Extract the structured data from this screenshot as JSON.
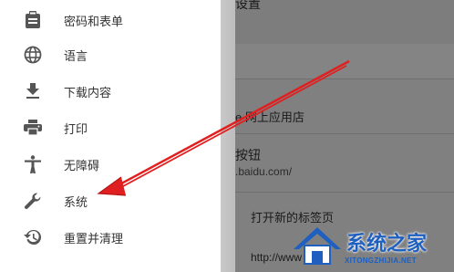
{
  "sidebar": {
    "items": [
      {
        "label": "密码和表单",
        "icon": "clipboard-icon"
      },
      {
        "label": "语言",
        "icon": "globe-icon"
      },
      {
        "label": "下载内容",
        "icon": "download-icon"
      },
      {
        "label": "打印",
        "icon": "printer-icon"
      },
      {
        "label": "无障碍",
        "icon": "accessibility-icon"
      },
      {
        "label": "系统",
        "icon": "wrench-icon"
      },
      {
        "label": "重置并清理",
        "icon": "restore-icon"
      }
    ]
  },
  "main": {
    "header_fragment": "设置",
    "webstore_fragment": "e 网上应用店",
    "button_fragment": "按钮",
    "url_fragment": ".baidu.com/",
    "new_tab_option": "打开新的标签页",
    "url_partial": "http://www"
  },
  "watermark": {
    "name": "系统之家",
    "domain": "XITONGZHIJIA.NET"
  },
  "colors": {
    "arrow": "#e02020",
    "overlay": "#808080",
    "watermark_blue": "#1e5fbf"
  }
}
